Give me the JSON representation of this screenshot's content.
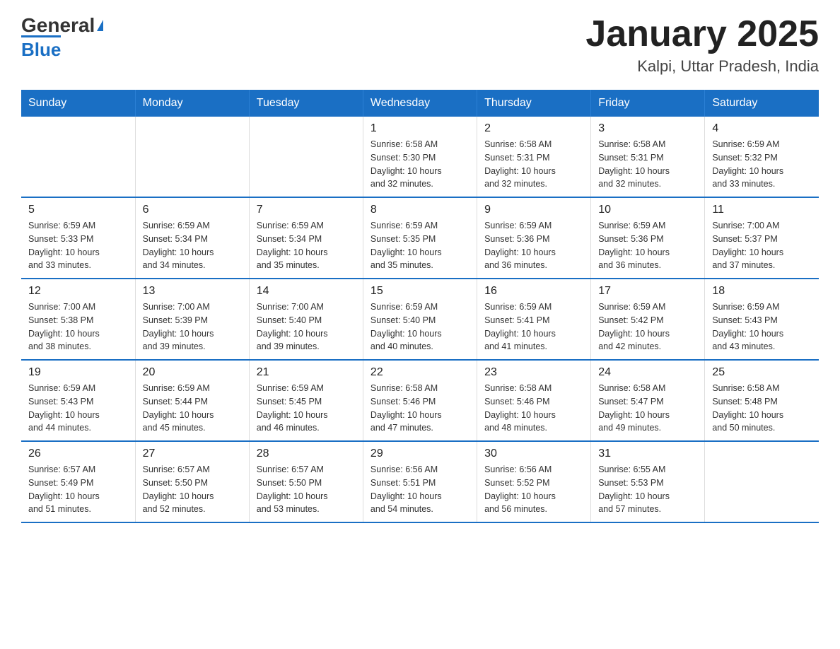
{
  "header": {
    "logo_general": "General",
    "logo_blue": "Blue",
    "title": "January 2025",
    "subtitle": "Kalpi, Uttar Pradesh, India"
  },
  "days_of_week": [
    "Sunday",
    "Monday",
    "Tuesday",
    "Wednesday",
    "Thursday",
    "Friday",
    "Saturday"
  ],
  "weeks": [
    [
      {
        "day": "",
        "info": ""
      },
      {
        "day": "",
        "info": ""
      },
      {
        "day": "",
        "info": ""
      },
      {
        "day": "1",
        "info": "Sunrise: 6:58 AM\nSunset: 5:30 PM\nDaylight: 10 hours\nand 32 minutes."
      },
      {
        "day": "2",
        "info": "Sunrise: 6:58 AM\nSunset: 5:31 PM\nDaylight: 10 hours\nand 32 minutes."
      },
      {
        "day": "3",
        "info": "Sunrise: 6:58 AM\nSunset: 5:31 PM\nDaylight: 10 hours\nand 32 minutes."
      },
      {
        "day": "4",
        "info": "Sunrise: 6:59 AM\nSunset: 5:32 PM\nDaylight: 10 hours\nand 33 minutes."
      }
    ],
    [
      {
        "day": "5",
        "info": "Sunrise: 6:59 AM\nSunset: 5:33 PM\nDaylight: 10 hours\nand 33 minutes."
      },
      {
        "day": "6",
        "info": "Sunrise: 6:59 AM\nSunset: 5:34 PM\nDaylight: 10 hours\nand 34 minutes."
      },
      {
        "day": "7",
        "info": "Sunrise: 6:59 AM\nSunset: 5:34 PM\nDaylight: 10 hours\nand 35 minutes."
      },
      {
        "day": "8",
        "info": "Sunrise: 6:59 AM\nSunset: 5:35 PM\nDaylight: 10 hours\nand 35 minutes."
      },
      {
        "day": "9",
        "info": "Sunrise: 6:59 AM\nSunset: 5:36 PM\nDaylight: 10 hours\nand 36 minutes."
      },
      {
        "day": "10",
        "info": "Sunrise: 6:59 AM\nSunset: 5:36 PM\nDaylight: 10 hours\nand 36 minutes."
      },
      {
        "day": "11",
        "info": "Sunrise: 7:00 AM\nSunset: 5:37 PM\nDaylight: 10 hours\nand 37 minutes."
      }
    ],
    [
      {
        "day": "12",
        "info": "Sunrise: 7:00 AM\nSunset: 5:38 PM\nDaylight: 10 hours\nand 38 minutes."
      },
      {
        "day": "13",
        "info": "Sunrise: 7:00 AM\nSunset: 5:39 PM\nDaylight: 10 hours\nand 39 minutes."
      },
      {
        "day": "14",
        "info": "Sunrise: 7:00 AM\nSunset: 5:40 PM\nDaylight: 10 hours\nand 39 minutes."
      },
      {
        "day": "15",
        "info": "Sunrise: 6:59 AM\nSunset: 5:40 PM\nDaylight: 10 hours\nand 40 minutes."
      },
      {
        "day": "16",
        "info": "Sunrise: 6:59 AM\nSunset: 5:41 PM\nDaylight: 10 hours\nand 41 minutes."
      },
      {
        "day": "17",
        "info": "Sunrise: 6:59 AM\nSunset: 5:42 PM\nDaylight: 10 hours\nand 42 minutes."
      },
      {
        "day": "18",
        "info": "Sunrise: 6:59 AM\nSunset: 5:43 PM\nDaylight: 10 hours\nand 43 minutes."
      }
    ],
    [
      {
        "day": "19",
        "info": "Sunrise: 6:59 AM\nSunset: 5:43 PM\nDaylight: 10 hours\nand 44 minutes."
      },
      {
        "day": "20",
        "info": "Sunrise: 6:59 AM\nSunset: 5:44 PM\nDaylight: 10 hours\nand 45 minutes."
      },
      {
        "day": "21",
        "info": "Sunrise: 6:59 AM\nSunset: 5:45 PM\nDaylight: 10 hours\nand 46 minutes."
      },
      {
        "day": "22",
        "info": "Sunrise: 6:58 AM\nSunset: 5:46 PM\nDaylight: 10 hours\nand 47 minutes."
      },
      {
        "day": "23",
        "info": "Sunrise: 6:58 AM\nSunset: 5:46 PM\nDaylight: 10 hours\nand 48 minutes."
      },
      {
        "day": "24",
        "info": "Sunrise: 6:58 AM\nSunset: 5:47 PM\nDaylight: 10 hours\nand 49 minutes."
      },
      {
        "day": "25",
        "info": "Sunrise: 6:58 AM\nSunset: 5:48 PM\nDaylight: 10 hours\nand 50 minutes."
      }
    ],
    [
      {
        "day": "26",
        "info": "Sunrise: 6:57 AM\nSunset: 5:49 PM\nDaylight: 10 hours\nand 51 minutes."
      },
      {
        "day": "27",
        "info": "Sunrise: 6:57 AM\nSunset: 5:50 PM\nDaylight: 10 hours\nand 52 minutes."
      },
      {
        "day": "28",
        "info": "Sunrise: 6:57 AM\nSunset: 5:50 PM\nDaylight: 10 hours\nand 53 minutes."
      },
      {
        "day": "29",
        "info": "Sunrise: 6:56 AM\nSunset: 5:51 PM\nDaylight: 10 hours\nand 54 minutes."
      },
      {
        "day": "30",
        "info": "Sunrise: 6:56 AM\nSunset: 5:52 PM\nDaylight: 10 hours\nand 56 minutes."
      },
      {
        "day": "31",
        "info": "Sunrise: 6:55 AM\nSunset: 5:53 PM\nDaylight: 10 hours\nand 57 minutes."
      },
      {
        "day": "",
        "info": ""
      }
    ]
  ]
}
